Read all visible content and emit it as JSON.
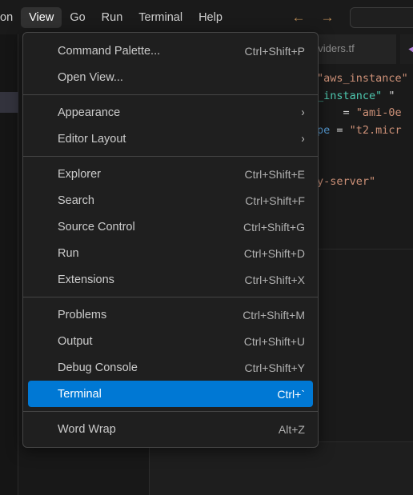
{
  "window": {
    "titlebar": {
      "menus": [
        {
          "label": "on",
          "state": "clipped"
        },
        {
          "label": "View",
          "state": "open"
        },
        {
          "label": "Go",
          "state": "normal"
        },
        {
          "label": "Run",
          "state": "normal"
        },
        {
          "label": "Terminal",
          "state": "normal"
        },
        {
          "label": "Help",
          "state": "normal"
        }
      ],
      "nav": {
        "back_icon": "arrow-left-icon",
        "back_glyph": "←",
        "forward_icon": "arrow-right-icon",
        "forward_glyph": "→"
      },
      "command_center": {
        "value": "",
        "placeholder": ""
      }
    }
  },
  "editor": {
    "tabs": [
      {
        "label": "oviders.tf",
        "active": false
      },
      {
        "label": "",
        "active": true,
        "icon": "terraform-file-icon"
      }
    ],
    "code_lines": [
      {
        "segments": [
          {
            "text": "\"aws_instance\" \"w",
            "cls": "c-str"
          }
        ]
      },
      {
        "segments": [
          {
            "text": "_instance\"",
            "cls": "c-type"
          },
          {
            "text": " \"",
            "cls": "c-punct"
          }
        ]
      },
      {
        "segments": [
          {
            "text": "    = ",
            "cls": "c-op"
          },
          {
            "text": "\"ami-0e",
            "cls": "c-str"
          }
        ]
      },
      {
        "segments": [
          {
            "text": "pe",
            "cls": "c-kw"
          },
          {
            "text": " = ",
            "cls": "c-op"
          },
          {
            "text": "\"t2.micr",
            "cls": "c-str"
          }
        ]
      },
      {
        "segments": []
      },
      {
        "segments": []
      },
      {
        "segments": [
          {
            "text": "y-server\"",
            "cls": "c-str"
          }
        ]
      }
    ]
  },
  "view_menu": {
    "name": "View",
    "groups": [
      {
        "items": [
          {
            "label": "Command Palette...",
            "accel": "Ctrl+Shift+P",
            "kind": "item"
          },
          {
            "label": "Open View...",
            "accel": "",
            "kind": "item"
          }
        ]
      },
      {
        "items": [
          {
            "label": "Appearance",
            "accel": "",
            "kind": "submenu",
            "chevron": "›"
          },
          {
            "label": "Editor Layout",
            "accel": "",
            "kind": "submenu",
            "chevron": "›"
          }
        ]
      },
      {
        "items": [
          {
            "label": "Explorer",
            "accel": "Ctrl+Shift+E",
            "kind": "item"
          },
          {
            "label": "Search",
            "accel": "Ctrl+Shift+F",
            "kind": "item"
          },
          {
            "label": "Source Control",
            "accel": "Ctrl+Shift+G",
            "kind": "item"
          },
          {
            "label": "Run",
            "accel": "Ctrl+Shift+D",
            "kind": "item"
          },
          {
            "label": "Extensions",
            "accel": "Ctrl+Shift+X",
            "kind": "item"
          }
        ]
      },
      {
        "items": [
          {
            "label": "Problems",
            "accel": "Ctrl+Shift+M",
            "kind": "item"
          },
          {
            "label": "Output",
            "accel": "Ctrl+Shift+U",
            "kind": "item"
          },
          {
            "label": "Debug Console",
            "accel": "Ctrl+Shift+Y",
            "kind": "item"
          },
          {
            "label": "Terminal",
            "accel": "Ctrl+`",
            "kind": "item",
            "selected": true
          }
        ]
      },
      {
        "items": [
          {
            "label": "Word Wrap",
            "accel": "Alt+Z",
            "kind": "item"
          }
        ]
      }
    ]
  },
  "colors": {
    "menu_bg": "#1f1f1f",
    "menu_border": "#454545",
    "selection_blue": "#0078d4",
    "titlebar_bg": "#1a1a1a",
    "editor_bg": "#1e1e1e",
    "sidebar_active": "#33333d",
    "tab_accent": "#0078d4",
    "text_primary": "#cccccc",
    "accel_text": "#b0b0b0",
    "string_orange": "#ce9178",
    "type_teal": "#4ec9b0",
    "keyword_blue": "#569cd6",
    "tf_icon_purple": "#b180d7",
    "nav_arrow": "#b98a55"
  }
}
